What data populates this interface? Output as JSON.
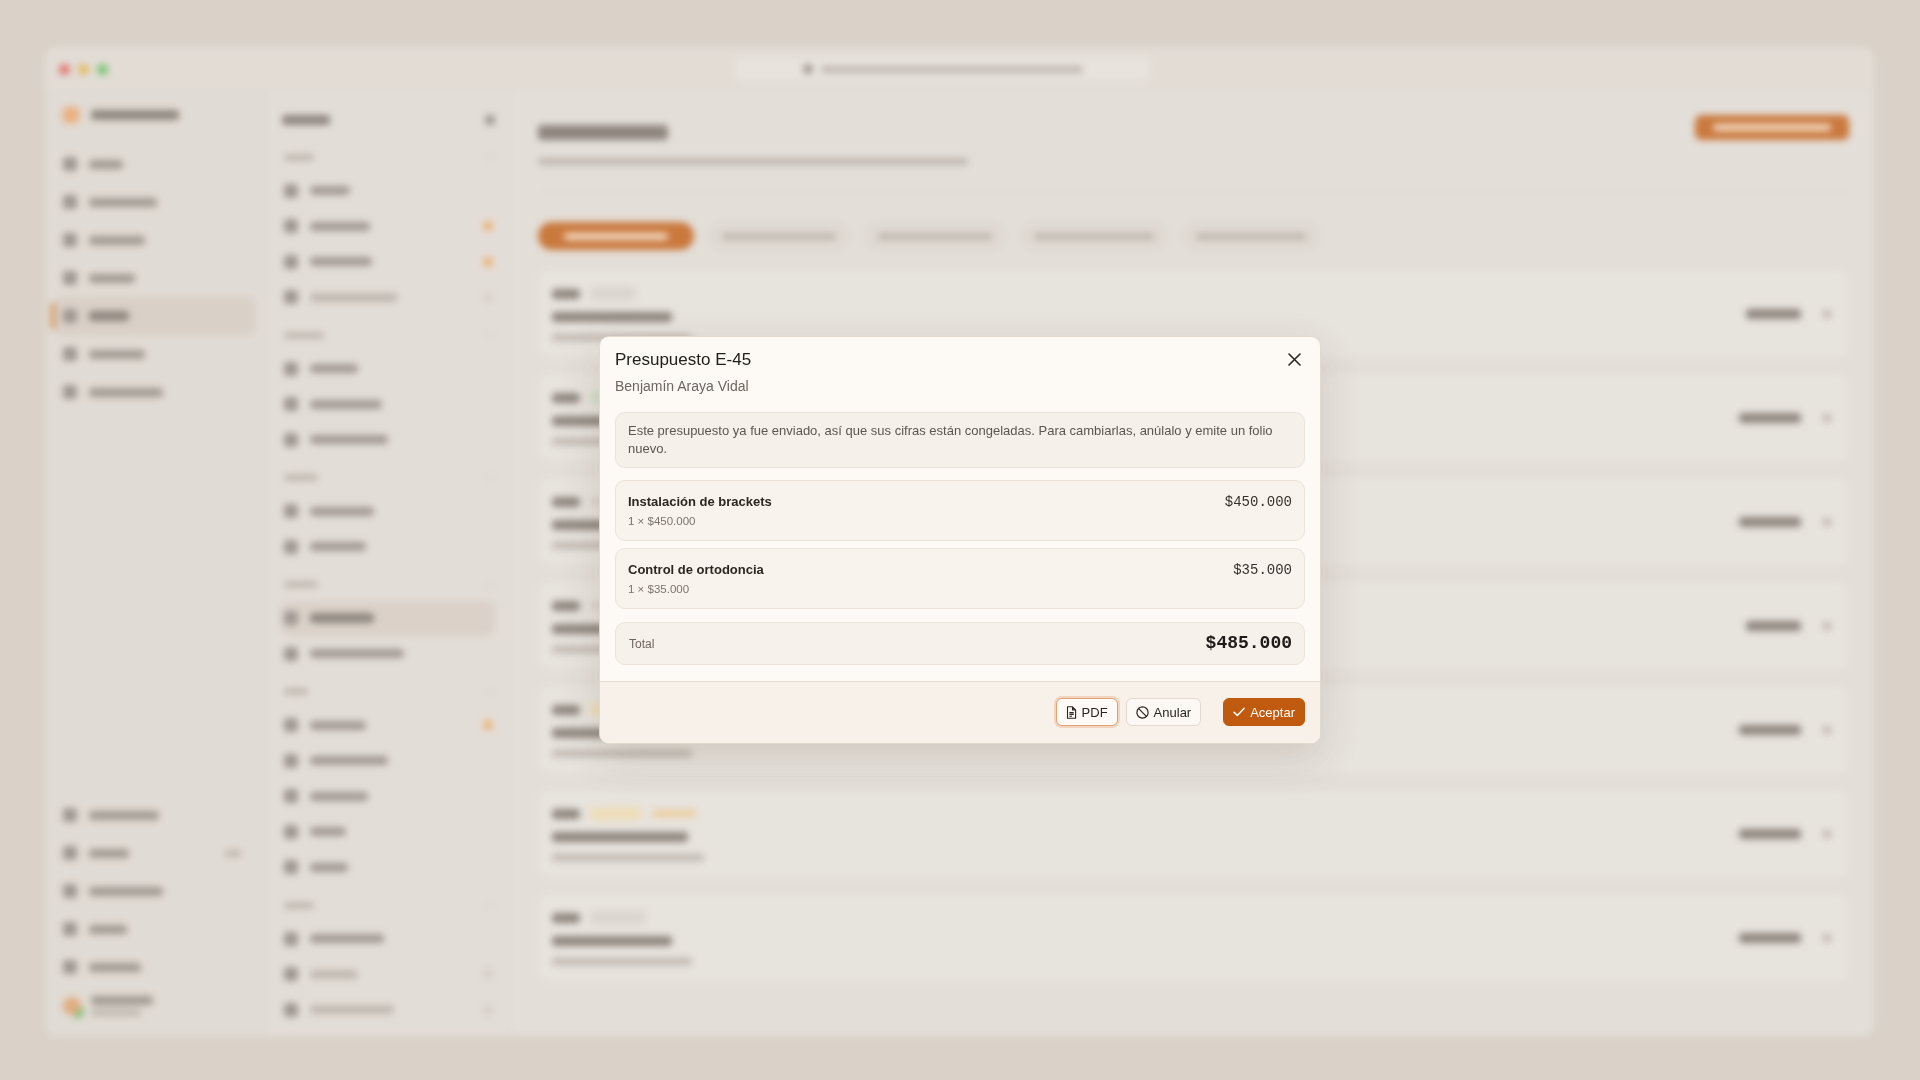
{
  "dialog": {
    "title": "Presupuesto E-45",
    "subtitle": "Benjamín Araya Vidal",
    "notice": "Este presupuesto ya fue enviado, así que sus cifras están congeladas. Para cambiarlas, anúlalo y emite un folio nuevo.",
    "line_items": [
      {
        "name": "Instalación de brackets",
        "detail": "1 × $450.000",
        "amount": "$450.000"
      },
      {
        "name": "Control de ortodoncia",
        "detail": "1 × $35.000",
        "amount": "$35.000"
      }
    ],
    "total": {
      "label": "Total",
      "amount": "$485.000"
    },
    "buttons": [
      {
        "label": "PDF",
        "kind": "export",
        "focused": true
      },
      {
        "label": "Anular",
        "kind": "void",
        "focused": false
      },
      {
        "label": "Aceptar",
        "kind": "accept",
        "focused": false
      }
    ]
  }
}
